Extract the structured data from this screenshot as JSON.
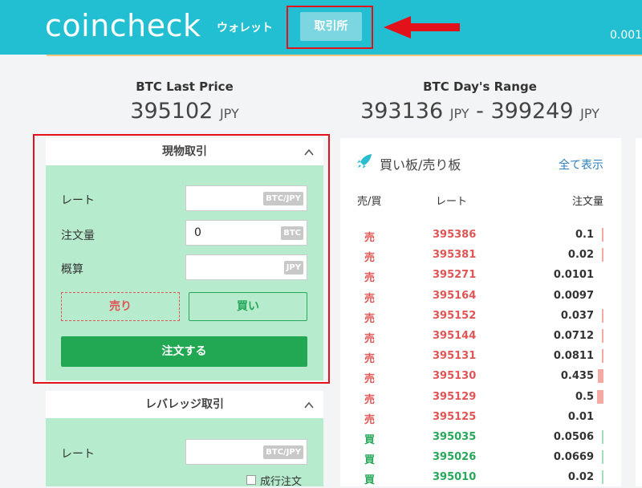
{
  "header": {
    "logo": "coincheck",
    "nav_wallet": "ウォレット",
    "nav_exchange": "取引所",
    "right_text": "0.001"
  },
  "last_price": {
    "label": "BTC Last Price",
    "value": "395102",
    "unit": "JPY"
  },
  "day_range": {
    "label": "BTC Day's Range",
    "low": "393136",
    "separator": "-",
    "high": "399249",
    "unit": "JPY"
  },
  "spot_panel": {
    "title": "現物取引",
    "rate_label": "レート",
    "rate_unit": "BTC/JPY",
    "amount_label": "注文量",
    "amount_value": "0",
    "amount_unit": "BTC",
    "estimate_label": "概算",
    "estimate_unit": "JPY",
    "sell_label": "売り",
    "buy_label": "買い",
    "order_label": "注文する"
  },
  "leverage_panel": {
    "title": "レバレッジ取引",
    "rate_label": "レート",
    "rate_unit": "BTC/JPY",
    "market_order_label": "成行注文"
  },
  "order_book": {
    "title": "買い板/売り板",
    "show_all": "全て表示",
    "col_side": "売/買",
    "col_rate": "レート",
    "col_qty": "注文量",
    "rows": [
      {
        "side": "売",
        "rate": "395386",
        "qty": "0.1",
        "type": "sell",
        "depth": 0.05
      },
      {
        "side": "売",
        "rate": "395381",
        "qty": "0.02",
        "type": "sell",
        "depth": 0.02
      },
      {
        "side": "売",
        "rate": "395271",
        "qty": "0.0101",
        "type": "sell",
        "depth": 0.0
      },
      {
        "side": "売",
        "rate": "395164",
        "qty": "0.0097",
        "type": "sell",
        "depth": 0.0
      },
      {
        "side": "売",
        "rate": "395152",
        "qty": "0.037",
        "type": "sell",
        "depth": 0.02
      },
      {
        "side": "売",
        "rate": "395144",
        "qty": "0.0712",
        "type": "sell",
        "depth": 0.03
      },
      {
        "side": "売",
        "rate": "395131",
        "qty": "0.0811",
        "type": "sell",
        "depth": 0.03
      },
      {
        "side": "売",
        "rate": "395130",
        "qty": "0.435",
        "type": "sell",
        "depth": 0.2
      },
      {
        "side": "売",
        "rate": "395129",
        "qty": "0.5",
        "type": "sell",
        "depth": 0.23
      },
      {
        "side": "売",
        "rate": "395125",
        "qty": "0.01",
        "type": "sell",
        "depth": 0.0
      },
      {
        "side": "買",
        "rate": "395035",
        "qty": "0.0506",
        "type": "buy",
        "depth": 0.02
      },
      {
        "side": "買",
        "rate": "395026",
        "qty": "0.0669",
        "type": "buy",
        "depth": 0.03
      },
      {
        "side": "買",
        "rate": "395010",
        "qty": "0.02",
        "type": "buy",
        "depth": 0.02
      }
    ]
  },
  "colors": {
    "header": "#22bfd2",
    "sell": "#e05555",
    "buy": "#27a85a",
    "highlight": "#e3121a"
  }
}
